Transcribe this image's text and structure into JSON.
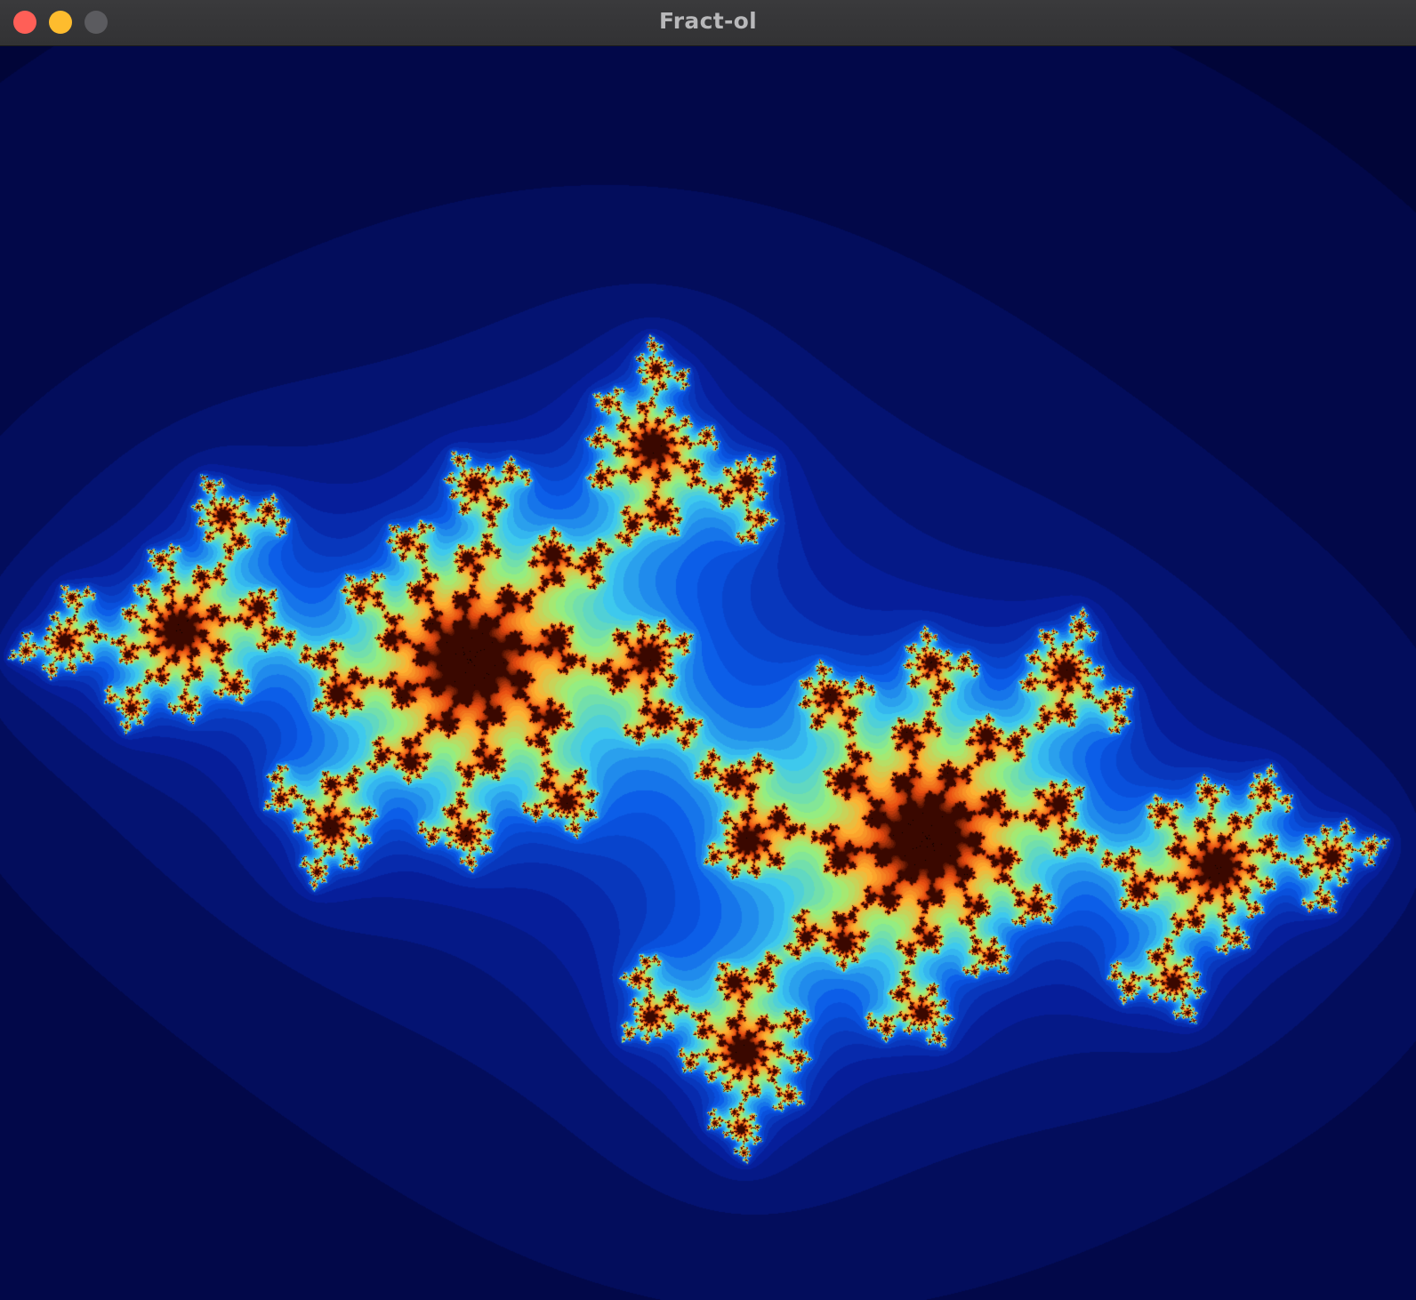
{
  "window": {
    "title": "Fract-ol"
  },
  "traffic_lights": {
    "close_color": "#ff5f57",
    "minimize_color": "#febc2e",
    "zoom_color": "#5b5b5f"
  },
  "fractal": {
    "type": "julia",
    "palette": [
      "#000020",
      "#020a50",
      "#0620a0",
      "#0a5ae8",
      "#3cc8f0",
      "#9af07a",
      "#ffb030",
      "#e84a10",
      "#3a0800",
      "#000000"
    ],
    "background_color": "#000000"
  }
}
